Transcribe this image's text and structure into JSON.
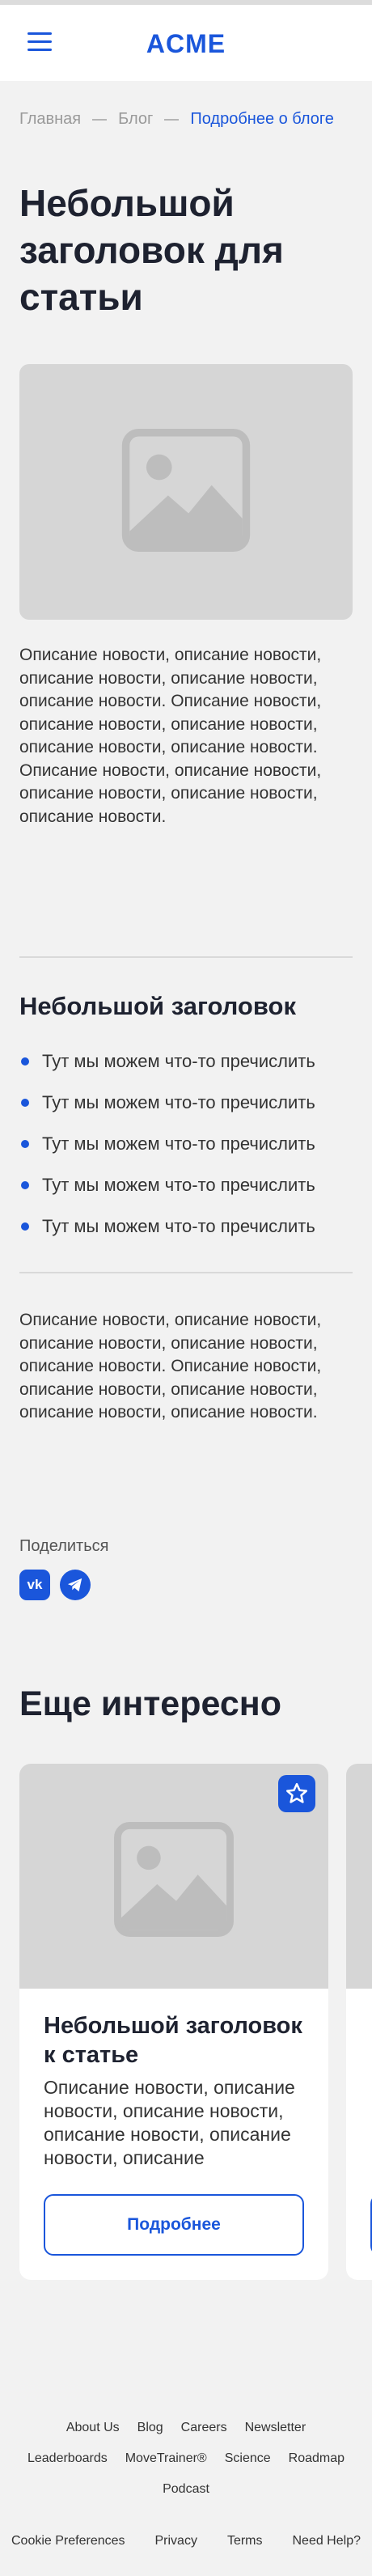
{
  "header": {
    "logo": "ACME",
    "menu_icon": "hamburger-menu-icon"
  },
  "breadcrumb": {
    "items": [
      "Главная",
      "Блог"
    ],
    "current": "Подробнее о блоге"
  },
  "article": {
    "title": "Небольшой заголовок для статьи",
    "paragraph1": "Описание новости, описание новости, описание новости, описание новости, описание новости. Описание новости, описание новости, описание новости, описание новости, описание новости. Описание новости, описание новости, описание новости, описание новости, описание новости.",
    "section_title": "Небольшой заголовок",
    "list": [
      "Тут мы можем что-то пречислить",
      "Тут мы можем что-то пречислить",
      "Тут мы можем что-то пречислить",
      "Тут мы можем что-то пречислить",
      "Тут мы можем что-то пречислить"
    ],
    "paragraph2": "Описание новости, описание новости, описание новости, описание новости, описание новости. Описание новости, описание новости, описание новости, описание новости, описание новости."
  },
  "share": {
    "label": "Поделиться",
    "vk_text": "vk",
    "icons": [
      "vk-icon",
      "telegram-icon"
    ]
  },
  "more": {
    "title": "Еще интересно",
    "card": {
      "title": "Небольшой заголовок к статье",
      "text": "Описание новости, описание новости, описание новости, описание новости, описание новости, описание",
      "button": "Подробнее",
      "favorite_icon": "star-icon"
    }
  },
  "footer": {
    "row1": [
      "About Us",
      "Blog",
      "Careers",
      "Newsletter"
    ],
    "row2": [
      "Leaderboards",
      "MoveTrainer®",
      "Science",
      "Roadmap"
    ],
    "row3": [
      "Podcast"
    ],
    "row4": [
      "Cookie Preferences",
      "Privacy",
      "Terms",
      "Need Help?"
    ]
  },
  "colors": {
    "accent": "#1a56db",
    "background": "#f2f2f2",
    "placeholder": "#d6d6d6"
  }
}
